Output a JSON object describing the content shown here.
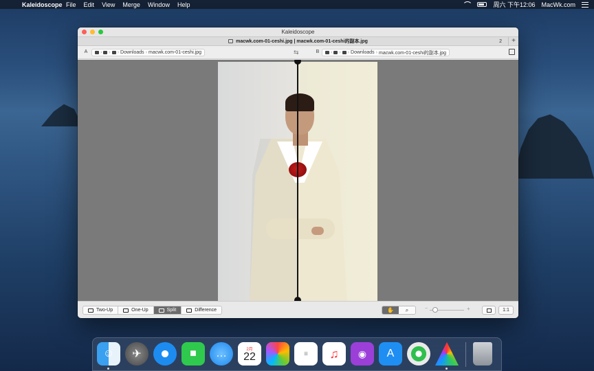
{
  "menubar": {
    "app_name": "Kaleidoscope",
    "menus": [
      "File",
      "Edit",
      "View",
      "Merge",
      "Window",
      "Help"
    ],
    "clock": "周六 下午12:06",
    "site": "MacWk.com"
  },
  "window": {
    "title": "Kaleidoscope",
    "tab_title": "macwk.com-01-ceshi.jpg | macwk.com-01-ceshi的副本.jpg",
    "tab_count": "2",
    "tab_add": "+"
  },
  "pathbar": {
    "side_a": "A",
    "side_b": "B",
    "a_folder": "Downloads",
    "a_file": "macwk.com-01-ceshi.jpg",
    "b_folder": "Downloads",
    "b_file": "macwk.com-01-ceshi的副本.jpg",
    "swap_glyph": "⇆"
  },
  "bottombar": {
    "modes": [
      {
        "label": "Two-Up",
        "active": false
      },
      {
        "label": "One-Up",
        "active": false
      },
      {
        "label": "Split",
        "active": true
      },
      {
        "label": "Difference",
        "active": false
      }
    ],
    "actual_size": "1:1",
    "zoom_minus": "−",
    "zoom_plus": "+"
  },
  "dock": {
    "icons": [
      "finder-icon",
      "launchpad-icon",
      "safari-icon",
      "facetime-icon",
      "messages-icon",
      "calendar-icon",
      "photos-icon",
      "reminders-icon",
      "music-icon",
      "podcasts-icon",
      "app-store-icon",
      "find-my-icon",
      "kaleidoscope-icon",
      "trash-icon"
    ],
    "calendar_month": "2月",
    "calendar_day": "22"
  },
  "colors": {
    "accent_active": "#6b6b6b",
    "close": "#fd5f57",
    "minimize": "#febc2e",
    "zoom": "#28c840"
  }
}
